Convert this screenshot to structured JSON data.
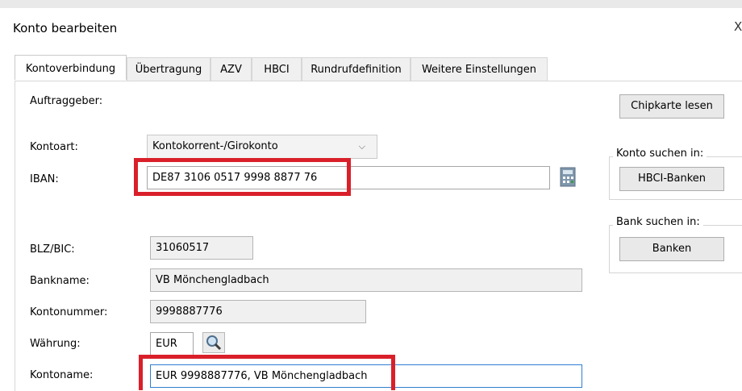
{
  "dialog": {
    "title": "Konto bearbeiten",
    "close_glyph": "X"
  },
  "tabs": [
    "Kontoverbindung",
    "Übertragung",
    "AZV",
    "HBCI",
    "Rundrufdefinition",
    "Weitere Einstellungen"
  ],
  "form": {
    "auftraggeber_label": "Auftraggeber:",
    "kontoart_label": "Kontoart:",
    "kontoart_value": "Kontokorrent-/Girokonto",
    "iban_label": "IBAN:",
    "iban_value": "DE87 3106 0517 9998 8877 76",
    "blz_label": "BLZ/BIC:",
    "blz_value": "31060517",
    "bankname_label": "Bankname:",
    "bankname_value": "VB Mönchengladbach",
    "kontonummer_label": "Kontonummer:",
    "kontonummer_value": "9998887776",
    "waehrung_label": "Währung:",
    "waehrung_value": "EUR",
    "kontoname_label": "Kontoname:",
    "kontoname_value": "EUR 9998887776, VB Mönchengladbach"
  },
  "side": {
    "chipkarte_button": "Chipkarte lesen",
    "konto_suchen_label": "Konto suchen in:",
    "hbci_banken_button": "HBCI-Banken",
    "bank_suchen_label": "Bank suchen in:",
    "banken_button": "Banken"
  },
  "icons": {
    "iban_lookup": "calculator-icon",
    "currency_search": "magnifier-icon",
    "dropdown": "chevron-down-icon"
  },
  "colors": {
    "highlight": "#d9202a",
    "focus_border": "#2f7fd1"
  }
}
